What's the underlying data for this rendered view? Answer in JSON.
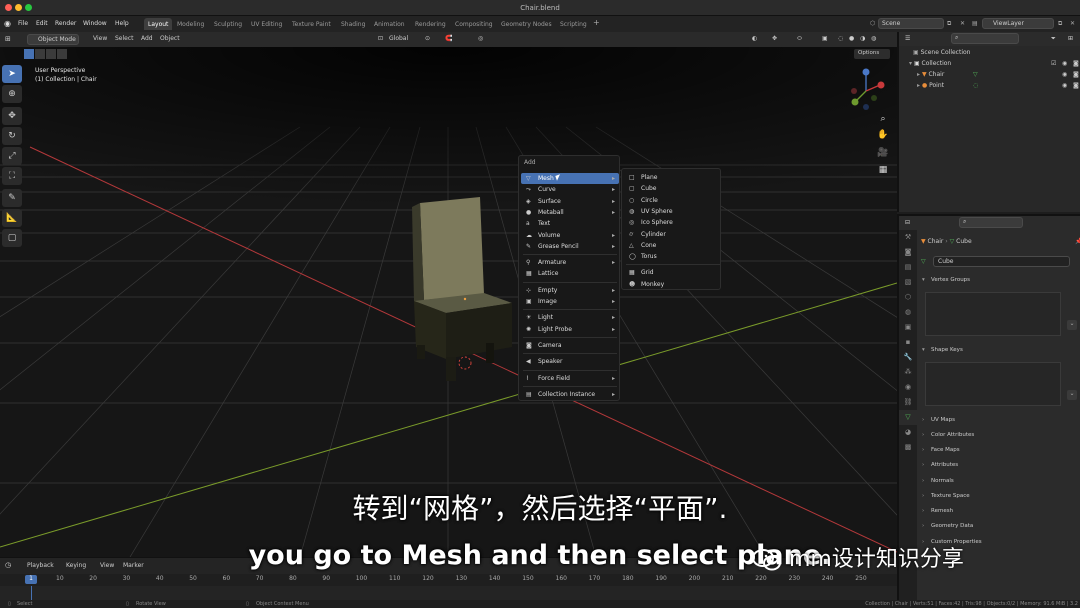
{
  "window": {
    "title": "Chair.blend"
  },
  "menubar": {
    "items": [
      "File",
      "Edit",
      "Render",
      "Window",
      "Help"
    ]
  },
  "workspaces": [
    "Layout",
    "Modeling",
    "Sculpting",
    "UV Editing",
    "Texture Paint",
    "Shading",
    "Animation",
    "Rendering",
    "Compositing",
    "Geometry Nodes",
    "Scripting"
  ],
  "scene": {
    "label": "Scene",
    "view_layer": "ViewLayer"
  },
  "header": {
    "mode": "Object Mode",
    "view": "View",
    "select": "Select",
    "add": "Add",
    "object": "Object",
    "orientation": "Global",
    "options": "Options"
  },
  "viewport": {
    "perspective": "User Perspective",
    "collection_path": "(1) Collection | Chair"
  },
  "add_menu": {
    "title": "Add",
    "items": [
      {
        "label": "Mesh",
        "icon": "mesh-icon",
        "glyph": "▽",
        "has_sub": true,
        "highlighted": true
      },
      {
        "label": "Curve",
        "icon": "curve-icon",
        "glyph": "⤳",
        "has_sub": true
      },
      {
        "label": "Surface",
        "icon": "surface-icon",
        "glyph": "◈",
        "has_sub": true
      },
      {
        "label": "Metaball",
        "icon": "metaball-icon",
        "glyph": "●",
        "has_sub": true
      },
      {
        "label": "Text",
        "icon": "text-icon",
        "glyph": "a",
        "has_sub": false
      },
      {
        "label": "Volume",
        "icon": "volume-icon",
        "glyph": "☁",
        "has_sub": true
      },
      {
        "label": "Grease Pencil",
        "icon": "grease-pencil-icon",
        "glyph": "✎",
        "has_sub": true
      },
      {
        "label": "Armature",
        "icon": "armature-icon",
        "glyph": "⚲",
        "has_sub": true
      },
      {
        "label": "Lattice",
        "icon": "lattice-icon",
        "glyph": "▦",
        "has_sub": false
      },
      {
        "label": "Empty",
        "icon": "empty-icon",
        "glyph": "⊹",
        "has_sub": true
      },
      {
        "label": "Image",
        "icon": "image-icon",
        "glyph": "▣",
        "has_sub": true
      },
      {
        "label": "Light",
        "icon": "light-icon",
        "glyph": "☀",
        "has_sub": true
      },
      {
        "label": "Light Probe",
        "icon": "light-probe-icon",
        "glyph": "✺",
        "has_sub": true
      },
      {
        "label": "Camera",
        "icon": "camera-icon",
        "glyph": "◙",
        "has_sub": false
      },
      {
        "label": "Speaker",
        "icon": "speaker-icon",
        "glyph": "◀",
        "has_sub": false
      },
      {
        "label": "Force Field",
        "icon": "force-field-icon",
        "glyph": "⌇",
        "has_sub": true
      },
      {
        "label": "Collection Instance",
        "icon": "collection-instance-icon",
        "glyph": "▤",
        "has_sub": true
      }
    ]
  },
  "mesh_submenu": {
    "items": [
      {
        "label": "Plane",
        "icon": "plane-icon",
        "glyph": "□"
      },
      {
        "label": "Cube",
        "icon": "cube-icon",
        "glyph": "▢"
      },
      {
        "label": "Circle",
        "icon": "circle-icon",
        "glyph": "○"
      },
      {
        "label": "UV Sphere",
        "icon": "uv-sphere-icon",
        "glyph": "◍"
      },
      {
        "label": "Ico Sphere",
        "icon": "ico-sphere-icon",
        "glyph": "◎"
      },
      {
        "label": "Cylinder",
        "icon": "cylinder-icon",
        "glyph": "⌭"
      },
      {
        "label": "Cone",
        "icon": "cone-icon",
        "glyph": "△"
      },
      {
        "label": "Torus",
        "icon": "torus-icon",
        "glyph": "◯"
      },
      {
        "label": "Grid",
        "icon": "grid-icon",
        "glyph": "▦"
      },
      {
        "label": "Monkey",
        "icon": "monkey-icon",
        "glyph": "☻"
      }
    ]
  },
  "outliner": {
    "root": "Scene Collection",
    "collection": "Collection",
    "objects": [
      "Chair",
      "Point"
    ]
  },
  "properties": {
    "breadcrumb_object": "Chair",
    "breadcrumb_data": "Cube",
    "mesh_name": "Cube",
    "panels": [
      "Vertex Groups",
      "Shape Keys",
      "UV Maps",
      "Color Attributes",
      "Face Maps",
      "Attributes",
      "Normals",
      "Texture Space",
      "Remesh",
      "Geometry Data",
      "Custom Properties"
    ]
  },
  "timeline": {
    "playback": "Playback",
    "keying": "Keying",
    "view": "View",
    "marker": "Marker",
    "current_frame": "1",
    "ticks": [
      "10",
      "20",
      "30",
      "40",
      "50",
      "60",
      "70",
      "80",
      "90",
      "100",
      "110",
      "120",
      "130",
      "140",
      "150",
      "160",
      "170",
      "180",
      "190",
      "200",
      "210",
      "220",
      "230",
      "240",
      "250"
    ]
  },
  "statusbar": {
    "left": "Select",
    "middle": "Rotate View",
    "right_action": "Object Context Menu",
    "stats": "Collection | Chair | Verts:51 | Faces:42 | Tris:98 | Objects:0/2 | Memory: 91.6 MiB | 3.2"
  },
  "subtitles": {
    "chinese": "转到“网格”，然后选择“平面”.",
    "english": "you go to Mesh and then select plane."
  },
  "watermark": {
    "text": "mm设计知识分享"
  },
  "colors": {
    "accent": "#4772b3",
    "x_axis": "#b3383a",
    "y_axis": "#7a9b2a",
    "mesh_green": "#55b95a"
  }
}
